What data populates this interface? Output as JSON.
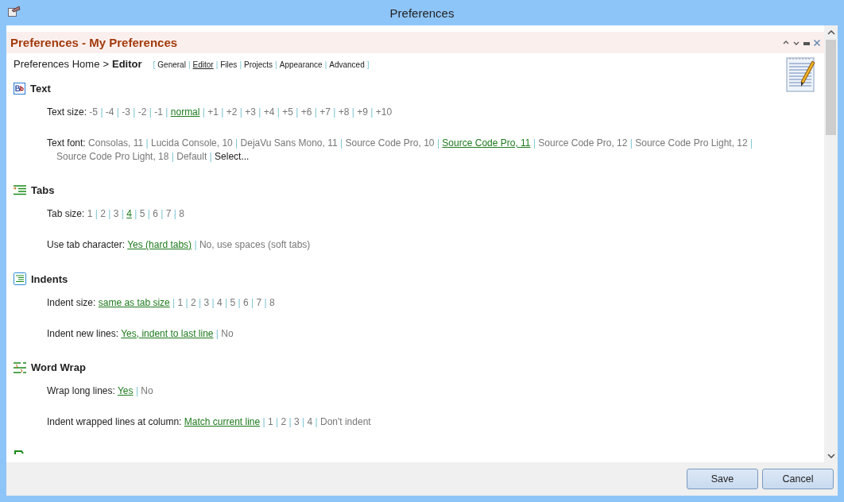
{
  "window": {
    "title": "Preferences"
  },
  "panel": {
    "title": "Preferences - My Preferences"
  },
  "breadcrumb": {
    "home": "Preferences Home",
    "separator": ">",
    "current": "Editor"
  },
  "nav": {
    "open": "[",
    "close": "]",
    "separator": "|",
    "items": [
      {
        "label": "General",
        "selected": false
      },
      {
        "label": "Editor",
        "selected": true
      },
      {
        "label": "Files",
        "selected": false
      },
      {
        "label": "Projects",
        "selected": false
      },
      {
        "label": "Appearance",
        "selected": false
      },
      {
        "label": "Advanced",
        "selected": false
      }
    ]
  },
  "option_separator": "|",
  "sections": [
    {
      "kind": "text",
      "title": "Text",
      "settings": [
        {
          "label": "Text size:",
          "options": [
            {
              "label": "-5",
              "selected": false
            },
            {
              "label": "-4",
              "selected": false
            },
            {
              "label": "-3",
              "selected": false
            },
            {
              "label": "-2",
              "selected": false
            },
            {
              "label": "-1",
              "selected": false
            },
            {
              "label": "normal",
              "selected": true
            },
            {
              "label": "+1",
              "selected": false
            },
            {
              "label": "+2",
              "selected": false
            },
            {
              "label": "+3",
              "selected": false
            },
            {
              "label": "+4",
              "selected": false
            },
            {
              "label": "+5",
              "selected": false
            },
            {
              "label": "+6",
              "selected": false
            },
            {
              "label": "+7",
              "selected": false
            },
            {
              "label": "+8",
              "selected": false
            },
            {
              "label": "+9",
              "selected": false
            },
            {
              "label": "+10",
              "selected": false
            }
          ]
        },
        {
          "label": "Text font:",
          "options": [
            {
              "label": "Consolas, 11",
              "selected": false
            },
            {
              "label": "Lucida Console, 10",
              "selected": false
            },
            {
              "label": "DejaVu Sans Mono, 11",
              "selected": false
            },
            {
              "label": "Source Code Pro, 10",
              "selected": false
            },
            {
              "label": "Source Code Pro, 11",
              "selected": true
            },
            {
              "label": "Source Code Pro, 12",
              "selected": false
            },
            {
              "label": "Source Code Pro Light, 12",
              "selected": false
            },
            {
              "label": "Source Code Pro Light, 18",
              "selected": false
            },
            {
              "label": "Default",
              "selected": false
            },
            {
              "label": "Select...",
              "selected": false,
              "kind": "action"
            }
          ]
        }
      ]
    },
    {
      "kind": "tabs",
      "title": "Tabs",
      "settings": [
        {
          "label": "Tab size:",
          "options": [
            {
              "label": "1",
              "selected": false
            },
            {
              "label": "2",
              "selected": false
            },
            {
              "label": "3",
              "selected": false
            },
            {
              "label": "4",
              "selected": true
            },
            {
              "label": "5",
              "selected": false
            },
            {
              "label": "6",
              "selected": false
            },
            {
              "label": "7",
              "selected": false
            },
            {
              "label": "8",
              "selected": false
            }
          ]
        },
        {
          "label": "Use tab character:",
          "options": [
            {
              "label": "Yes (hard tabs)",
              "selected": true
            },
            {
              "label": "No, use spaces (soft tabs)",
              "selected": false
            }
          ]
        }
      ]
    },
    {
      "kind": "indents",
      "title": "Indents",
      "settings": [
        {
          "label": "Indent size:",
          "options": [
            {
              "label": "same as tab size",
              "selected": true
            },
            {
              "label": "1",
              "selected": false
            },
            {
              "label": "2",
              "selected": false
            },
            {
              "label": "3",
              "selected": false
            },
            {
              "label": "4",
              "selected": false
            },
            {
              "label": "5",
              "selected": false
            },
            {
              "label": "6",
              "selected": false
            },
            {
              "label": "7",
              "selected": false
            },
            {
              "label": "8",
              "selected": false
            }
          ]
        },
        {
          "label": "Indent new lines:",
          "options": [
            {
              "label": "Yes, indent to last line",
              "selected": true
            },
            {
              "label": "No",
              "selected": false
            }
          ]
        }
      ]
    },
    {
      "kind": "wrap",
      "title": "Word Wrap",
      "settings": [
        {
          "label": "Wrap long lines:",
          "options": [
            {
              "label": "Yes",
              "selected": true
            },
            {
              "label": "No",
              "selected": false
            }
          ]
        },
        {
          "label": "Indent wrapped lines at column:",
          "options": [
            {
              "label": "Match current line",
              "selected": true
            },
            {
              "label": "1",
              "selected": false
            },
            {
              "label": "2",
              "selected": false
            },
            {
              "label": "3",
              "selected": false
            },
            {
              "label": "4",
              "selected": false
            },
            {
              "label": "Don't indent",
              "selected": false
            }
          ]
        }
      ]
    },
    {
      "kind": "cut"
    }
  ],
  "buttons": [
    {
      "label": "Save"
    },
    {
      "label": "Cancel"
    }
  ]
}
